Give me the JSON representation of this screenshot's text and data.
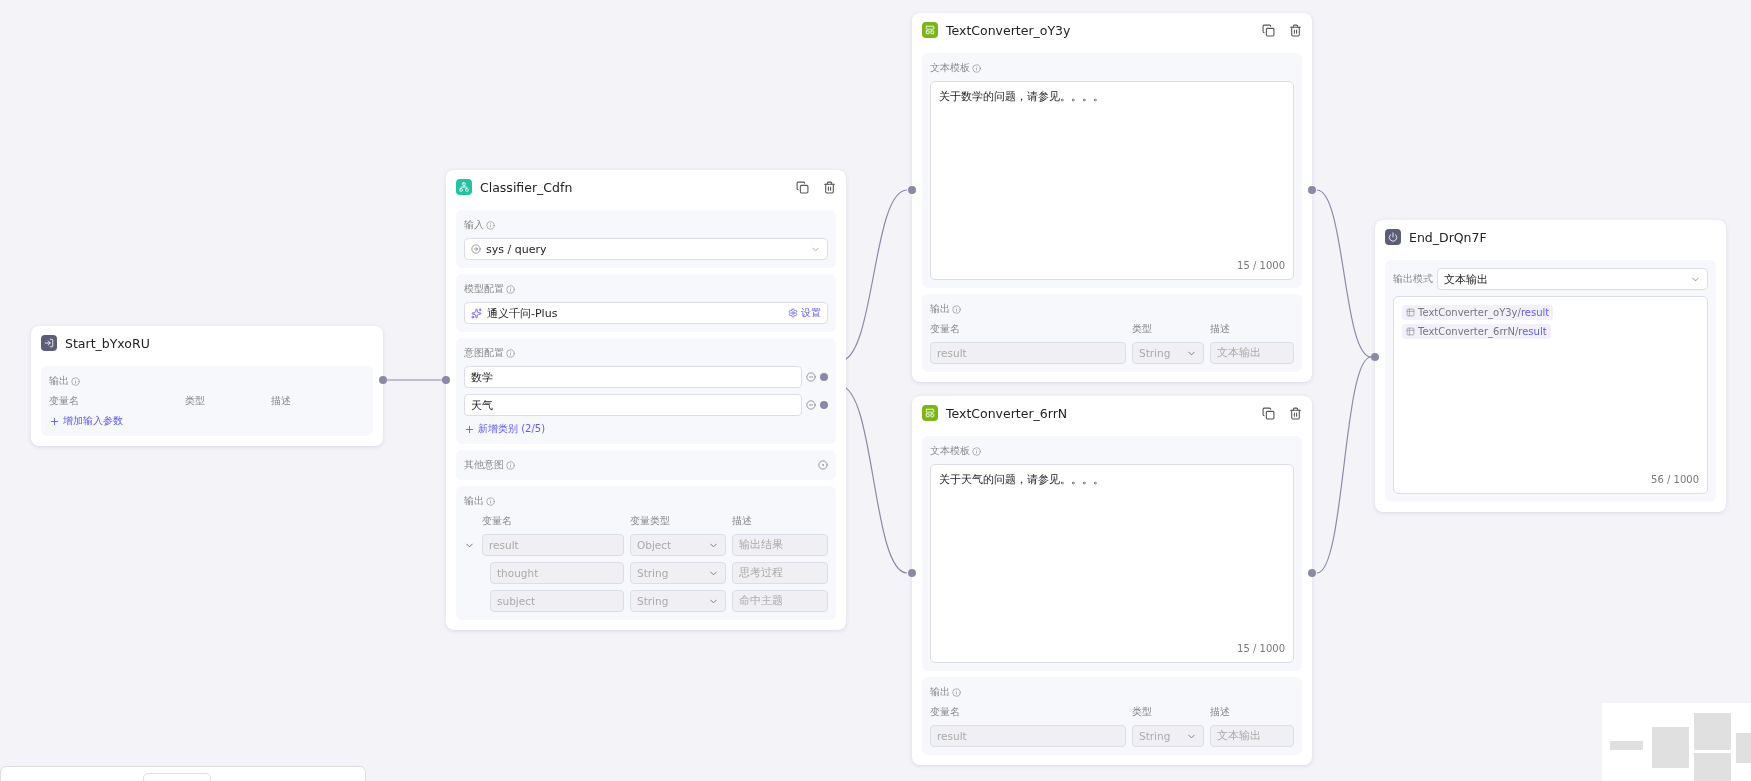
{
  "start": {
    "title": "Start_bYxoRU",
    "output_label": "输出",
    "columns": [
      "变量名",
      "类型",
      "描述"
    ],
    "add_link": "增加输入参数"
  },
  "classifier": {
    "title": "Classifier_Cdfn",
    "input": {
      "label": "输入",
      "value": "sys / query"
    },
    "model": {
      "label": "模型配置",
      "name": "通义千问-Plus",
      "settings": "设置"
    },
    "intents": {
      "label": "意图配置",
      "items": [
        "数学",
        "天气"
      ],
      "add_link": "新增类别 (2/5)"
    },
    "other": {
      "label": "其他意图"
    },
    "output": {
      "label": "输出",
      "columns": [
        "变量名",
        "变量类型",
        "描述"
      ],
      "rows": [
        {
          "name": "result",
          "type": "Object",
          "desc": "输出结果",
          "expanded": true,
          "children": [
            {
              "name": "thought",
              "type": "String",
              "desc": "思考过程"
            },
            {
              "name": "subject",
              "type": "String",
              "desc": "命中主题"
            }
          ]
        }
      ]
    }
  },
  "converters": [
    {
      "title": "TextConverter_oY3y",
      "template_label": "文本模板",
      "template": "关于数学的问题，请参见。。。。",
      "count": "15 / 1000",
      "output_label": "输出",
      "columns": [
        "变量名",
        "类型",
        "描述"
      ],
      "row": {
        "name": "result",
        "type": "String",
        "desc": "文本输出"
      }
    },
    {
      "title": "TextConverter_6rrN",
      "template_label": "文本模板",
      "template": "关于天气的问题，请参见。。。。",
      "count": "15 / 1000",
      "output_label": "输出",
      "columns": [
        "变量名",
        "类型",
        "描述"
      ],
      "row": {
        "name": "result",
        "type": "String",
        "desc": "文本输出"
      }
    }
  ],
  "end": {
    "title": "End_DrQn7F",
    "mode_label": "输出模式",
    "mode": "文本输出",
    "refs": [
      {
        "node": "TextConverter_oY3y/",
        "var": "result"
      },
      {
        "node": "TextConverter_6rrN/",
        "var": "result"
      }
    ],
    "count": "56 / 1000"
  }
}
